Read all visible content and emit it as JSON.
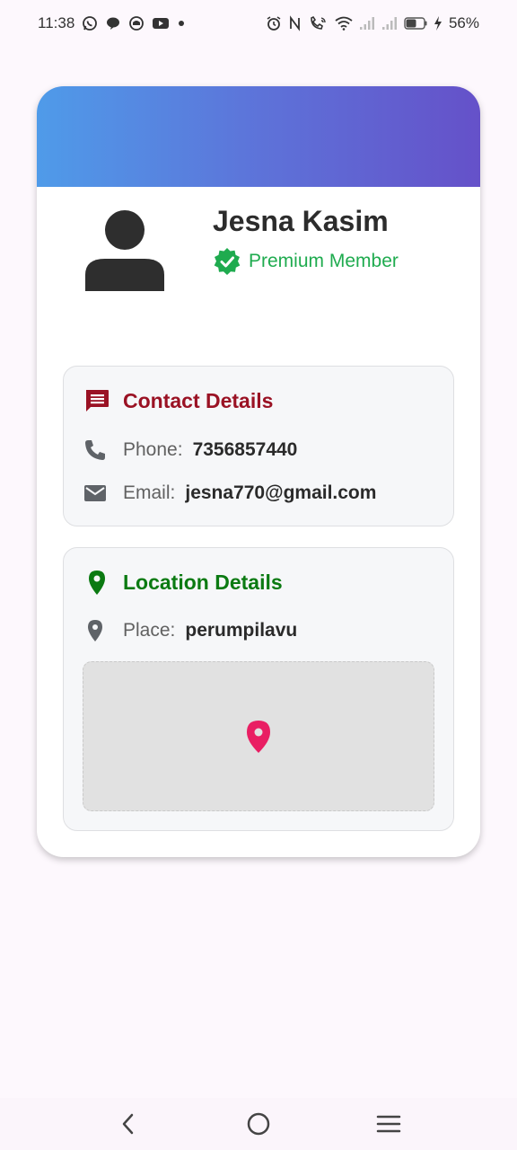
{
  "status_bar": {
    "time": "11:38",
    "battery_percent": "56%",
    "left_icons": [
      "whatsapp-icon",
      "chat-icon",
      "app-icon",
      "youtube-icon",
      "dot-icon"
    ],
    "right_icons": [
      "alarm-icon",
      "nfc-icon",
      "volte-call-icon",
      "wifi-icon",
      "signal-icon",
      "signal-icon",
      "battery-icon",
      "charging-icon"
    ]
  },
  "profile": {
    "name": "Jesna Kasim",
    "membership": "Premium Member"
  },
  "contact": {
    "title": "Contact Details",
    "phone_label": "Phone:",
    "phone_value": "7356857440",
    "email_label": "Email:",
    "email_value": "jesna770@gmail.com"
  },
  "location": {
    "title": "Location Details",
    "place_label": "Place:",
    "place_value": "perumpilavu"
  },
  "colors": {
    "header_gradient_start": "#4f9be9",
    "header_gradient_end": "#6551c9",
    "premium_green": "#1fab4f",
    "contact_title": "#9a1224",
    "location_title": "#0b7a12",
    "map_pin": "#e91e63"
  },
  "nav_bar": {
    "buttons": [
      "back-icon",
      "home-icon",
      "recents-icon"
    ]
  }
}
